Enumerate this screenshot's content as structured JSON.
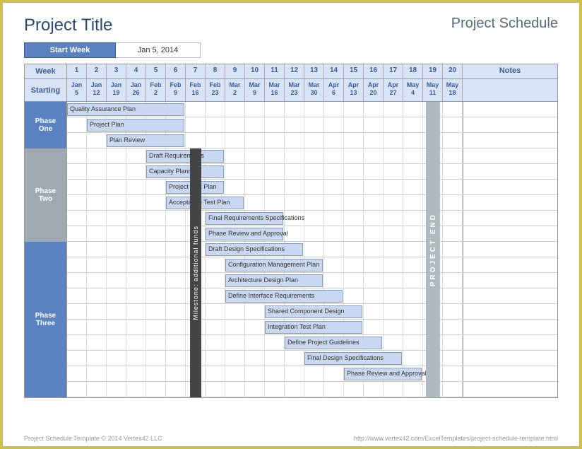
{
  "header": {
    "title": "Project Title",
    "subtitle": "Project Schedule"
  },
  "start": {
    "label": "Start Week",
    "value": "Jan 5, 2014"
  },
  "columns": {
    "week_label": "Week",
    "starting_label": "Starting",
    "notes_label": "Notes",
    "weeks": [
      1,
      2,
      3,
      4,
      5,
      6,
      7,
      8,
      9,
      10,
      11,
      12,
      13,
      14,
      15,
      16,
      17,
      18,
      19,
      20
    ],
    "dates": [
      "Jan 5",
      "Jan 12",
      "Jan 19",
      "Jan 26",
      "Feb 2",
      "Feb 9",
      "Feb 16",
      "Feb 23",
      "Mar 2",
      "Mar 9",
      "Mar 16",
      "Mar 23",
      "Mar 30",
      "Apr 6",
      "Apr 13",
      "Apr 20",
      "Apr 27",
      "May 4",
      "May 11",
      "May 18"
    ]
  },
  "phases": [
    {
      "name": "Phase One",
      "row": 0,
      "span": 3,
      "gray": false
    },
    {
      "name": "Phase Two",
      "row": 3,
      "span": 6,
      "gray": true
    },
    {
      "name": "Phase Three",
      "row": 9,
      "span": 10,
      "gray": false
    }
  ],
  "milestones": [
    {
      "label": "Milestone: additional funds",
      "col": 7,
      "row": 3,
      "span": 16
    }
  ],
  "project_end": {
    "label": "PROJECT END",
    "col": 19
  },
  "footer": {
    "left": "Project Schedule Template © 2014 Vertex42 LLC",
    "right": "http://www.vertex42.com/ExcelTemplates/project-schedule-template.html"
  },
  "chart_data": {
    "type": "bar",
    "title": "Project Schedule",
    "xlabel": "Week",
    "x": [
      1,
      2,
      3,
      4,
      5,
      6,
      7,
      8,
      9,
      10,
      11,
      12,
      13,
      14,
      15,
      16,
      17,
      18,
      19,
      20
    ],
    "x_dates": [
      "Jan 5",
      "Jan 12",
      "Jan 19",
      "Jan 26",
      "Feb 2",
      "Feb 9",
      "Feb 16",
      "Feb 23",
      "Mar 2",
      "Mar 9",
      "Mar 16",
      "Mar 23",
      "Mar 30",
      "Apr 6",
      "Apr 13",
      "Apr 20",
      "Apr 27",
      "May 4",
      "May 11",
      "May 18"
    ],
    "series": [
      {
        "name": "Quality Assurance Plan",
        "phase": "Phase One",
        "start": 1,
        "duration": 6
      },
      {
        "name": "Project Plan",
        "phase": "Phase One",
        "start": 2,
        "duration": 5
      },
      {
        "name": "Plan Review",
        "phase": "Phase One",
        "start": 3,
        "duration": 4
      },
      {
        "name": "Draft Requirements",
        "phase": "Phase Two",
        "start": 5,
        "duration": 4
      },
      {
        "name": "Capacity Planning",
        "phase": "Phase Two",
        "start": 5,
        "duration": 4
      },
      {
        "name": "Project Test Plan",
        "phase": "Phase Two",
        "start": 6,
        "duration": 3
      },
      {
        "name": "Acceptance Test Plan",
        "phase": "Phase Two",
        "start": 6,
        "duration": 4
      },
      {
        "name": "Final Requirements Specifications",
        "phase": "Phase Two",
        "start": 8,
        "duration": 4
      },
      {
        "name": "Phase Review and Approval",
        "phase": "Phase Two",
        "start": 8,
        "duration": 4
      },
      {
        "name": "Draft Design Specifications",
        "phase": "Phase Three",
        "start": 8,
        "duration": 5
      },
      {
        "name": "Configuration Management Plan",
        "phase": "Phase Three",
        "start": 9,
        "duration": 5
      },
      {
        "name": "Architecture Design Plan",
        "phase": "Phase Three",
        "start": 9,
        "duration": 5
      },
      {
        "name": "Define Interface Requirements",
        "phase": "Phase Three",
        "start": 9,
        "duration": 6
      },
      {
        "name": "Shared Component Design",
        "phase": "Phase Three",
        "start": 11,
        "duration": 5
      },
      {
        "name": "Integration Test Plan",
        "phase": "Phase Three",
        "start": 11,
        "duration": 5
      },
      {
        "name": "Define Project Guidelines",
        "phase": "Phase Three",
        "start": 12,
        "duration": 5
      },
      {
        "name": "Final Design Specifications",
        "phase": "Phase Three",
        "start": 13,
        "duration": 5
      },
      {
        "name": "Phase Review and Approval",
        "phase": "Phase Three",
        "start": 15,
        "duration": 4
      }
    ],
    "milestones": [
      {
        "name": "Milestone: additional funds",
        "week": 7
      }
    ],
    "project_end_week": 19
  }
}
